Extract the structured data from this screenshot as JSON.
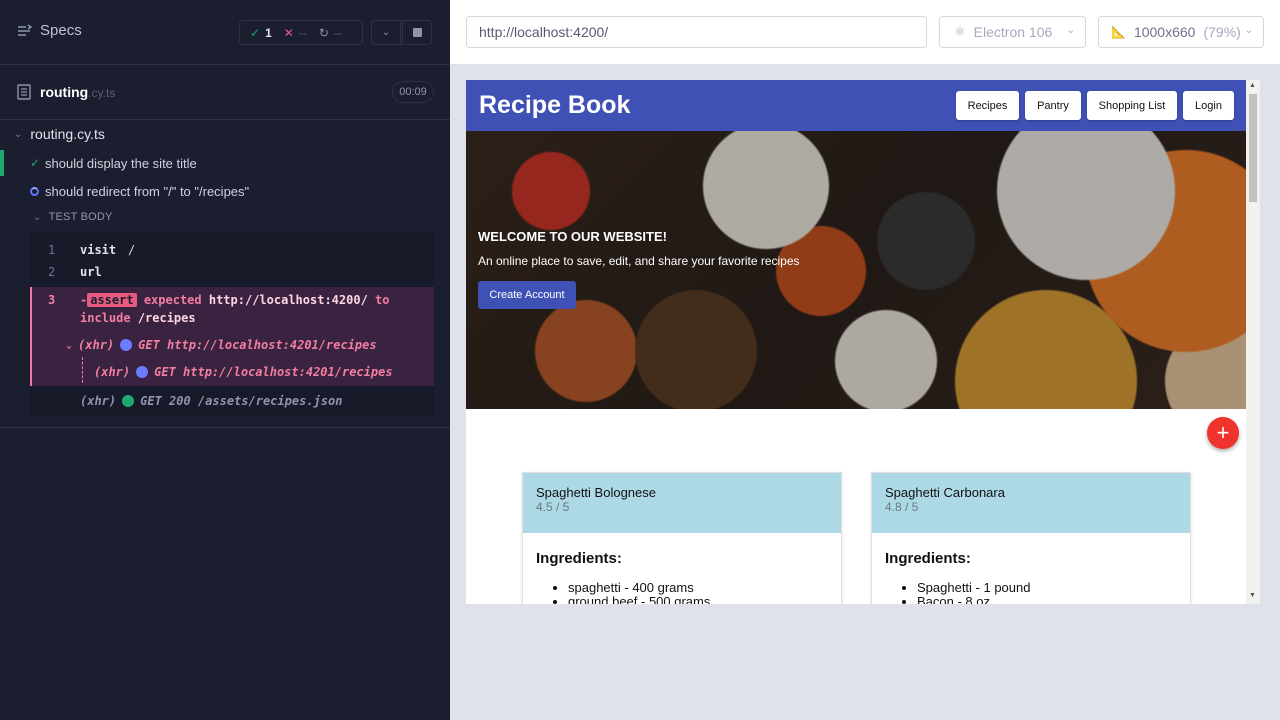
{
  "reporter": {
    "specs_label": "Specs",
    "stats": {
      "passed": "1",
      "failed": "--",
      "pending": "--"
    },
    "spec_file": {
      "name": "routing",
      "ext": ".cy.ts",
      "duration": "00:09"
    },
    "suite": {
      "title": "routing.cy.ts"
    },
    "tests": [
      {
        "title": "should display the site title",
        "state": "passed"
      },
      {
        "title": "should redirect from \"/\" to \"/recipes\"",
        "state": "running"
      }
    ],
    "body_label": "TEST BODY",
    "commands": [
      {
        "num": "1",
        "name": "visit",
        "message": "/"
      },
      {
        "num": "2",
        "name": "url",
        "message": ""
      }
    ],
    "failed_command": {
      "num": "3",
      "prefix": "-",
      "badge": "assert",
      "text_a": "expected",
      "url": "http://localhost:4200/",
      "text_b": "to",
      "text_c": "include",
      "path": "/recipes"
    },
    "xhr": [
      {
        "label": "(xhr)",
        "request": "GET http://localhost:4201/recipes"
      },
      {
        "label": "(xhr)",
        "request": "GET http://localhost:4201/recipes"
      },
      {
        "label": "(xhr)",
        "request": "GET 200 /assets/recipes.json"
      }
    ]
  },
  "aut": {
    "url": "http://localhost:4200/",
    "browser": "Electron 106",
    "viewport": "1000x660",
    "zoom": "(79%)"
  },
  "app": {
    "title": "Recipe Book",
    "nav": [
      "Recipes",
      "Pantry",
      "Shopping List",
      "Login"
    ],
    "hero": {
      "welcome": "WELCOME TO OUR WEBSITE!",
      "subtitle": "An online place to save, edit, and share your favorite recipes",
      "cta": "Create Account"
    },
    "fab": "+",
    "cards": [
      {
        "title": "Spaghetti Bolognese",
        "rating": "4.5 / 5",
        "ingredients_label": "Ingredients:",
        "items": [
          "spaghetti - 400 grams",
          "ground beef - 500 grams"
        ]
      },
      {
        "title": "Spaghetti Carbonara",
        "rating": "4.8 / 5",
        "ingredients_label": "Ingredients:",
        "items": [
          "Spaghetti - 1 pound",
          "Bacon - 8 oz"
        ]
      }
    ]
  },
  "colors": {
    "reporter_bg": "#1b1e2e",
    "pass": "#1fa971",
    "fail": "#f27ea1",
    "nav_blue": "#3f51b5",
    "card_header": "#add8e6",
    "fab": "#f0332c"
  }
}
